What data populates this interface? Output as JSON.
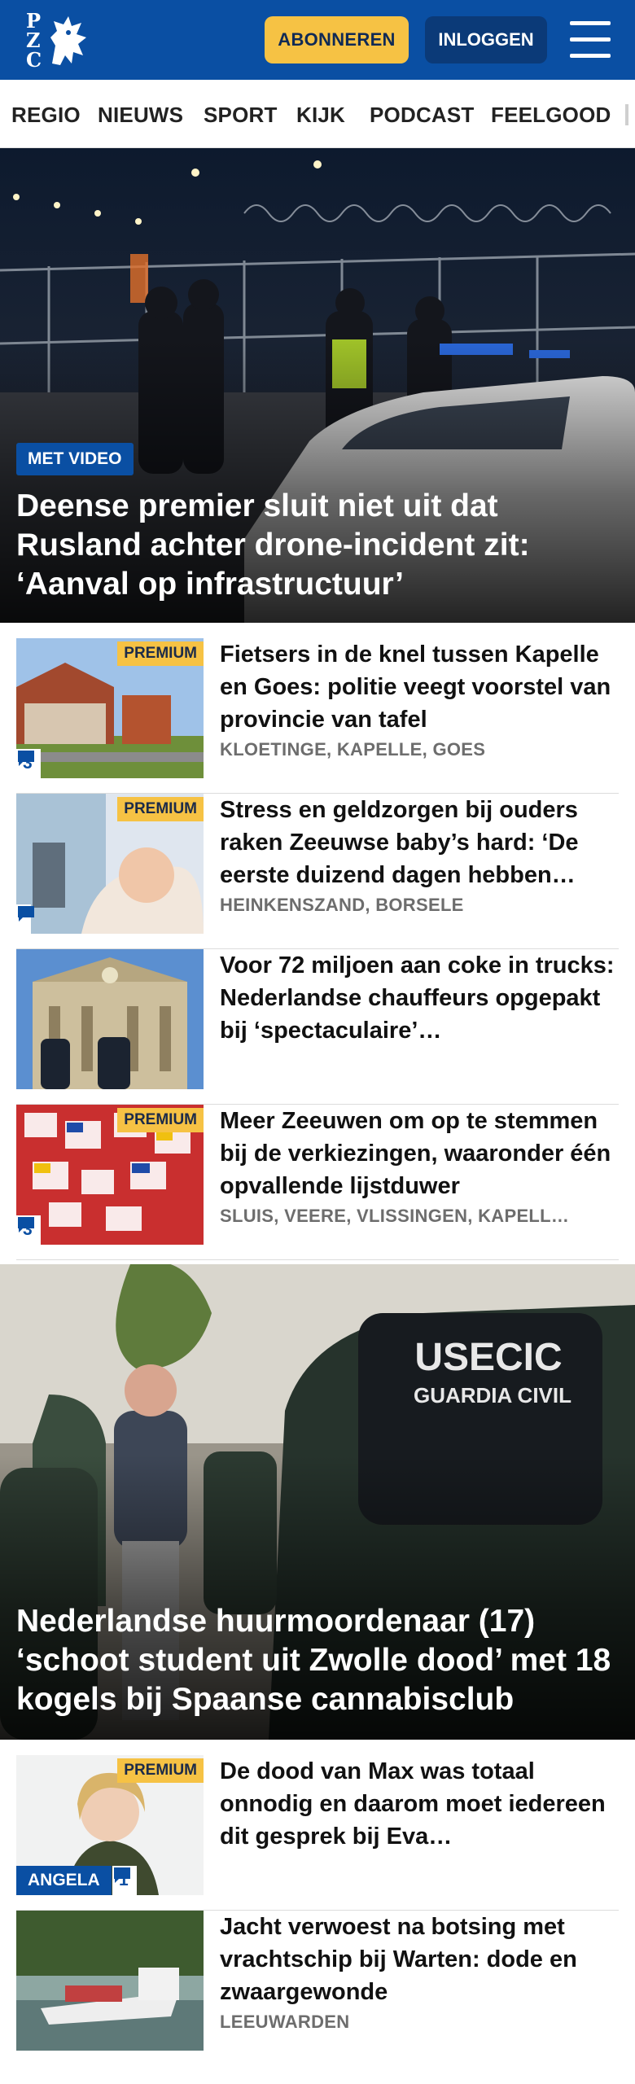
{
  "header": {
    "logo_letters": [
      "P",
      "Z",
      "C"
    ],
    "subscribe_label": "ABONNEREN",
    "login_label": "INLOGGEN",
    "menu_icon": "hamburger-menu-icon",
    "colors": {
      "brand_blue": "#0a4fa3",
      "accent_yellow": "#f6c244"
    }
  },
  "nav": {
    "items": [
      "REGIO",
      "NIEUWS",
      "SPORT",
      "KIJK",
      "PODCAST",
      "FEELGOOD"
    ]
  },
  "hero_top": {
    "badge": "MET VIDEO",
    "title": "Deense premier sluit niet uit dat Rusland achter drone-incident zit: ‘Aanval op infrastructuur’"
  },
  "articles_1": [
    {
      "premium": "PREMIUM",
      "headline": "Fietsers in de knel tussen Kapelle en Goes: politie veegt voorstel van provincie van tafel",
      "location": "KLOETINGE, KAPELLE, GOES",
      "comments": "3"
    },
    {
      "premium": "PREMIUM",
      "headline": "Stress en geldzorgen bij ouders raken Zeeuwse baby’s hard: ‘De eerste duizend dagen hebben…",
      "location": "HEINKENSZAND, BORSELE",
      "comments": ""
    },
    {
      "headline": "Voor 72 miljoen aan coke in trucks: Nederlandse chauffeurs opgepakt bij ‘spectaculaire’…"
    },
    {
      "premium": "PREMIUM",
      "headline": "Meer Zeeuwen om op te stemmen bij de verkiezingen, waaronder één opvallende lijstduwer",
      "location": "SLUIS, VEERE, VLISSINGEN, KAPELL…",
      "comments": "3"
    }
  ],
  "hero_second": {
    "title": "Nederlandse huurmoordenaar (17) ‘schoot student uit Zwolle dood’ met 18 kogels bij Spaanse cannabisclub",
    "vest_text_1": "USECIC",
    "vest_text_2": "GUARDIA CIVIL"
  },
  "articles_2": [
    {
      "premium": "PREMIUM",
      "tag": "ANGELA",
      "headline": "De dood van Max was totaal onnodig en daarom moet iedereen dit gesprek bij Eva…",
      "comments": "1"
    },
    {
      "headline": "Jacht verwoest na botsing met vrachtschip bij Warten: dode en zwaargewonde",
      "location": "LEEUWARDEN"
    }
  ]
}
